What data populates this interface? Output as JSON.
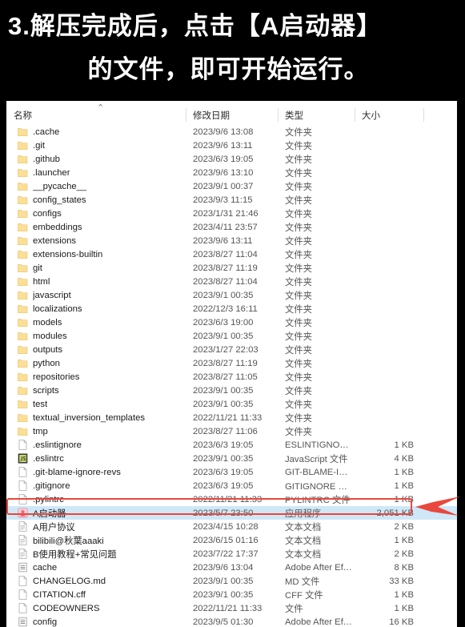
{
  "caption": {
    "line1": "3.解压完成后，点击【A启动器】",
    "line2": "的文件，即可开始运行。"
  },
  "explorer": {
    "columns": {
      "name": "名称",
      "date": "修改日期",
      "type": "类型",
      "size": "大小"
    },
    "sort_indicator": "⌃",
    "folder_type_label": "文件夹",
    "rows": [
      {
        "icon": "folder-icon",
        "name": ".cache",
        "date": "2023/9/6 13:08",
        "type": "文件夹",
        "size": ""
      },
      {
        "icon": "folder-icon",
        "name": ".git",
        "date": "2023/9/6 13:11",
        "type": "文件夹",
        "size": ""
      },
      {
        "icon": "folder-icon",
        "name": ".github",
        "date": "2023/6/3 19:05",
        "type": "文件夹",
        "size": ""
      },
      {
        "icon": "folder-icon",
        "name": ".launcher",
        "date": "2023/9/6 13:10",
        "type": "文件夹",
        "size": ""
      },
      {
        "icon": "folder-icon",
        "name": "__pycache__",
        "date": "2023/9/1 00:37",
        "type": "文件夹",
        "size": ""
      },
      {
        "icon": "folder-icon",
        "name": "config_states",
        "date": "2023/9/3 11:15",
        "type": "文件夹",
        "size": ""
      },
      {
        "icon": "folder-icon",
        "name": "configs",
        "date": "2023/1/31 21:46",
        "type": "文件夹",
        "size": ""
      },
      {
        "icon": "folder-icon",
        "name": "embeddings",
        "date": "2023/4/11 23:57",
        "type": "文件夹",
        "size": ""
      },
      {
        "icon": "folder-icon",
        "name": "extensions",
        "date": "2023/9/6 13:11",
        "type": "文件夹",
        "size": ""
      },
      {
        "icon": "folder-icon",
        "name": "extensions-builtin",
        "date": "2023/8/27 11:04",
        "type": "文件夹",
        "size": ""
      },
      {
        "icon": "folder-icon",
        "name": "git",
        "date": "2023/8/27 11:19",
        "type": "文件夹",
        "size": ""
      },
      {
        "icon": "folder-icon",
        "name": "html",
        "date": "2023/8/27 11:04",
        "type": "文件夹",
        "size": ""
      },
      {
        "icon": "folder-icon",
        "name": "javascript",
        "date": "2023/9/1 00:35",
        "type": "文件夹",
        "size": ""
      },
      {
        "icon": "folder-icon",
        "name": "localizations",
        "date": "2022/12/3 16:11",
        "type": "文件夹",
        "size": ""
      },
      {
        "icon": "folder-icon",
        "name": "models",
        "date": "2023/6/3 19:00",
        "type": "文件夹",
        "size": ""
      },
      {
        "icon": "folder-icon",
        "name": "modules",
        "date": "2023/9/1 00:35",
        "type": "文件夹",
        "size": ""
      },
      {
        "icon": "folder-icon",
        "name": "outputs",
        "date": "2023/1/27 22:03",
        "type": "文件夹",
        "size": ""
      },
      {
        "icon": "folder-icon",
        "name": "python",
        "date": "2023/8/27 11:19",
        "type": "文件夹",
        "size": ""
      },
      {
        "icon": "folder-icon",
        "name": "repositories",
        "date": "2023/8/27 11:05",
        "type": "文件夹",
        "size": ""
      },
      {
        "icon": "folder-icon",
        "name": "scripts",
        "date": "2023/9/1 00:35",
        "type": "文件夹",
        "size": ""
      },
      {
        "icon": "folder-icon",
        "name": "test",
        "date": "2023/9/1 00:35",
        "type": "文件夹",
        "size": ""
      },
      {
        "icon": "folder-icon",
        "name": "textual_inversion_templates",
        "date": "2022/11/21 11:33",
        "type": "文件夹",
        "size": ""
      },
      {
        "icon": "folder-icon",
        "name": "tmp",
        "date": "2023/8/27 11:06",
        "type": "文件夹",
        "size": ""
      },
      {
        "icon": "file-icon",
        "name": ".eslintignore",
        "date": "2023/6/3 19:05",
        "type": "ESLINTIGNORE ...",
        "size": "1 KB"
      },
      {
        "icon": "js-file-icon",
        "name": ".eslintrc",
        "date": "2023/9/1 00:35",
        "type": "JavaScript 文件",
        "size": "4 KB"
      },
      {
        "icon": "file-icon",
        "name": ".git-blame-ignore-revs",
        "date": "2023/6/3 19:05",
        "type": "GIT-BLAME-IGN...",
        "size": "1 KB"
      },
      {
        "icon": "file-icon",
        "name": ".gitignore",
        "date": "2023/6/3 19:05",
        "type": "GITIGNORE 文件",
        "size": "1 KB"
      },
      {
        "icon": "file-icon",
        "name": ".pylintrc",
        "date": "2022/11/21 11:33",
        "type": "PYLINTRC 文件",
        "size": "1 KB"
      },
      {
        "icon": "app-icon",
        "name": "A启动器",
        "date": "2023/5/7 23:50",
        "type": "应用程序",
        "size": "2,051 KB",
        "selected": true
      },
      {
        "icon": "text-file-icon",
        "name": "A用户协议",
        "date": "2023/4/15 10:28",
        "type": "文本文档",
        "size": "2 KB"
      },
      {
        "icon": "text-file-icon",
        "name": "bilibili@秋葉aaaki",
        "date": "2023/6/15 01:16",
        "type": "文本文档",
        "size": "1 KB"
      },
      {
        "icon": "text-file-icon",
        "name": "B使用教程+常见问题",
        "date": "2023/7/22 17:37",
        "type": "文本文档",
        "size": "2 KB"
      },
      {
        "icon": "ae-file-icon",
        "name": "cache",
        "date": "2023/9/6 13:04",
        "type": "Adobe After Effe...",
        "size": "8 KB"
      },
      {
        "icon": "file-icon",
        "name": "CHANGELOG.md",
        "date": "2023/9/1 00:35",
        "type": "MD 文件",
        "size": "33 KB"
      },
      {
        "icon": "file-icon",
        "name": "CITATION.cff",
        "date": "2023/9/1 00:35",
        "type": "CFF 文件",
        "size": "1 KB"
      },
      {
        "icon": "file-icon",
        "name": "CODEOWNERS",
        "date": "2022/11/21 11:33",
        "type": "文件",
        "size": "1 KB"
      },
      {
        "icon": "ae-file-icon",
        "name": "config",
        "date": "2023/9/5 01:30",
        "type": "Adobe After Effe...",
        "size": "16 KB"
      }
    ]
  },
  "annotation": {
    "highlight_color": "#e8483d",
    "selection_color": "#cfe8f7",
    "target_row": "A启动器"
  }
}
